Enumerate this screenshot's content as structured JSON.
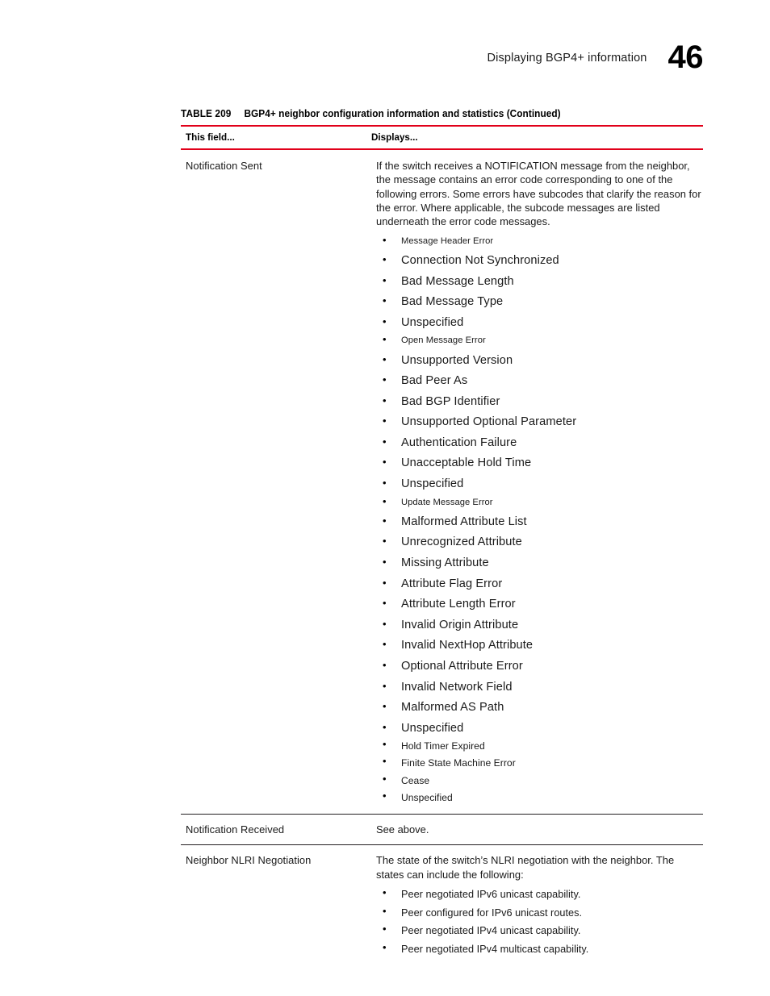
{
  "header": {
    "title": "Displaying BGP4+ information",
    "chapter_number": "46"
  },
  "table": {
    "caption_label": "TABLE 209",
    "caption_text": "BGP4+ neighbor configuration information and statistics  (Continued)",
    "columns": {
      "field": "This field...",
      "displays": "Displays..."
    },
    "rows": [
      {
        "field": "Notification Sent",
        "description": "If the switch receives a NOTIFICATION message from the neighbor, the message contains an error code corresponding to one of the following errors.  Some errors have subcodes that clarify the reason for the error. Where applicable, the subcode messages are listed underneath the error code messages.",
        "items": [
          {
            "text": "Message Header Error",
            "style": "head"
          },
          {
            "text": "Connection Not Synchronized",
            "style": "item"
          },
          {
            "text": "Bad Message Length",
            "style": "item"
          },
          {
            "text": "Bad Message Type",
            "style": "item"
          },
          {
            "text": "Unspecified",
            "style": "item"
          },
          {
            "text": "Open Message Error",
            "style": "head"
          },
          {
            "text": "Unsupported Version",
            "style": "item"
          },
          {
            "text": "Bad Peer As",
            "style": "item"
          },
          {
            "text": "Bad BGP Identifier",
            "style": "item"
          },
          {
            "text": "Unsupported Optional Parameter",
            "style": "item"
          },
          {
            "text": "Authentication Failure",
            "style": "item"
          },
          {
            "text": "Unacceptable Hold Time",
            "style": "item"
          },
          {
            "text": "Unspecified",
            "style": "item"
          },
          {
            "text": "Update Message Error",
            "style": "head"
          },
          {
            "text": "Malformed Attribute List",
            "style": "item"
          },
          {
            "text": "Unrecognized Attribute",
            "style": "item"
          },
          {
            "text": "Missing Attribute",
            "style": "item"
          },
          {
            "text": "Attribute Flag Error",
            "style": "item"
          },
          {
            "text": "Attribute Length Error",
            "style": "item"
          },
          {
            "text": "Invalid Origin Attribute",
            "style": "item"
          },
          {
            "text": "Invalid NextHop Attribute",
            "style": "item"
          },
          {
            "text": "Optional Attribute Error",
            "style": "item"
          },
          {
            "text": "Invalid Network Field",
            "style": "item"
          },
          {
            "text": "Malformed AS Path",
            "style": "item"
          },
          {
            "text": "Unspecified",
            "style": "item"
          },
          {
            "text": "Hold Timer Expired",
            "style": "tight"
          },
          {
            "text": "Finite State Machine Error",
            "style": "tight"
          },
          {
            "text": "Cease",
            "style": "tight"
          },
          {
            "text": "Unspecified",
            "style": "tight"
          }
        ]
      },
      {
        "field": "Notification Received",
        "description": "See above."
      },
      {
        "field": "Neighbor NLRI Negotiation",
        "description": "The state of the switch’s NLRI negotiation with the neighbor. The states can include the following:",
        "items": [
          {
            "text": "Peer negotiated IPv6 unicast capability.",
            "style": "nlri"
          },
          {
            "text": "Peer configured for IPv6 unicast routes.",
            "style": "nlri"
          },
          {
            "text": "Peer negotiated IPv4 unicast capability.",
            "style": "nlri"
          },
          {
            "text": "Peer negotiated IPv4 multicast capability.",
            "style": "nlri"
          }
        ]
      }
    ]
  },
  "colors": {
    "rule_red": "#e1001a",
    "rule_dark": "#231f20",
    "text": "#1a1a1a"
  }
}
